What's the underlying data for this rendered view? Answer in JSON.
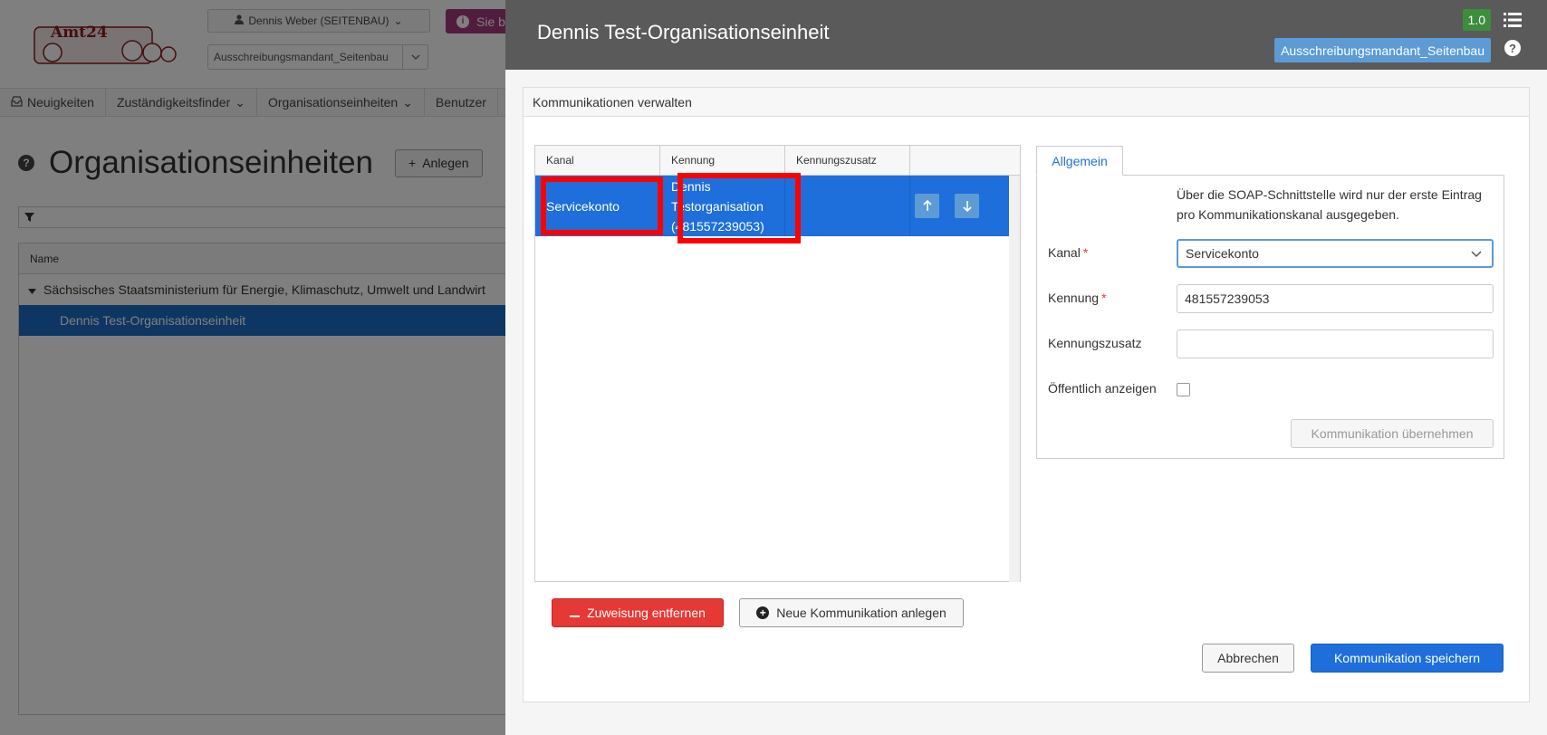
{
  "background": {
    "logo_text": "Amt24",
    "user_menu": "Dennis Weber (SEITENBAU)",
    "mandant_select": "Ausschreibungsmandant_Seitenbau",
    "info_pill": "Sie b",
    "nav": [
      "Neuigkeiten",
      "Zuständigkeitsfinder",
      "Organisationseinheiten",
      "Benutzer"
    ],
    "page_title": "Organisationseinheiten",
    "anlegen_label": "Anlegen",
    "tree_header": "Name",
    "tree_rows": [
      "Sächsisches Staatsministerium für Energie, Klimaschutz, Umwelt und Landwirt",
      "Dennis Test-Organisationseinheit"
    ]
  },
  "panel": {
    "title": "Dennis Test-Organisationseinheit",
    "version": "1.0",
    "mandant": "Ausschreibungsmandant_Seitenbau",
    "card_title": "Kommunikationen verwalten",
    "grid": {
      "columns": [
        "Kanal",
        "Kennung",
        "Kennungszusatz",
        ""
      ],
      "rows": [
        {
          "kanal": "Servicekonto",
          "kennung_lines": [
            "Dennis",
            "Testorganisation",
            "(481557239053)"
          ],
          "zusatz": ""
        }
      ]
    },
    "remove_label": "Zuweisung entfernen",
    "new_label": "Neue Kommunikation anlegen",
    "cancel_label": "Abbrechen",
    "save_label": "Kommunikation speichern",
    "tab_label": "Allgemein",
    "info_text": "Über die SOAP-Schnittstelle wird nur der erste Eintrag pro Kommunikationskanal ausgegeben.",
    "form": {
      "kanal_label": "Kanal",
      "kanal_value": "Servicekonto",
      "kennung_label": "Kennung",
      "kennung_value": "481557239053",
      "zusatz_label": "Kennungszusatz",
      "zusatz_value": "",
      "public_label": "Öffentlich anzeigen",
      "public_checked": false,
      "apply_label": "Kommunikation übernehmen"
    }
  },
  "colors": {
    "primary": "#1e6fdc",
    "danger": "#e53935",
    "header_bg": "#5a5a5a",
    "badge_green": "#3c8e3c",
    "badge_blue": "#5c9bd6",
    "highlight": "#ff0000"
  }
}
